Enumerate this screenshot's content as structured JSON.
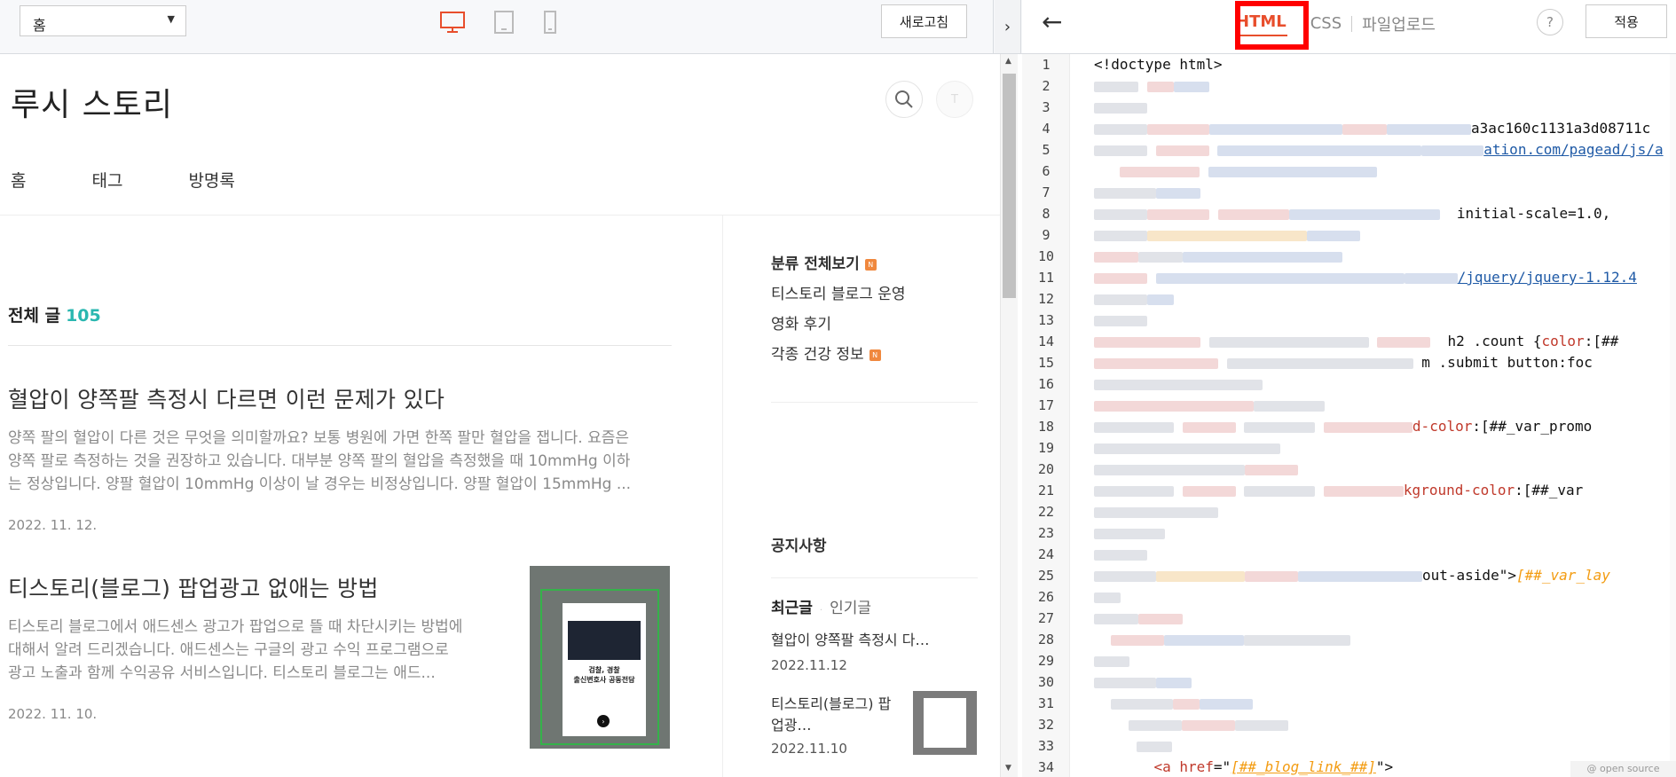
{
  "preview_bar": {
    "page_select": {
      "value": "홈"
    },
    "refresh_label": "새로고침",
    "collapse_label": "›"
  },
  "editor_bar": {
    "back_label": "←",
    "tabs": [
      {
        "label": "HTML",
        "active": true
      },
      {
        "label": "CSS",
        "active": false
      },
      {
        "label": "파일업로드",
        "active": false
      }
    ],
    "help_label": "?",
    "apply_label": "적용",
    "accent_color": "#e84e2c",
    "highlight_color": "#ff0000"
  },
  "blog": {
    "title": "루시 스토리",
    "profile_initial": "T",
    "nav": [
      "홈",
      "태그",
      "방명록"
    ],
    "total_label": "전체 글",
    "total_count": "105",
    "posts": [
      {
        "title": "혈압이 양쪽팔 측정시 다르면 이런 문제가 있다",
        "excerpt": "양쪽 팔의 혈압이 다른 것은 무엇을 의미할까요? 보통 병원에 가면 한쪽 팔만 혈압을 잽니다. 요즘은 양쪽 팔로 측정하는 것을 권장하고 있습니다. 대부분 양쪽 팔의 혈압을 측정했을 때 10mmHg 이하는 정상입니다. 양팔 혈압이 10mmHg 이상이 날 경우는 비정상입니다. 양팔 혈압이 15mmHg ...",
        "date": "2022. 11. 12."
      },
      {
        "title": "티스토리(블로그) 팝업광고 없애는 방법",
        "excerpt": "티스토리 블로그에서 애드센스 광고가 팝업으로 뜰 때 차단시키는 방법에 대해서 알려 드리겠습니다. 애드센스는 구글의 광고 수익 프로그램으로 광고 노출과 함께 수익공유 서비스입니다. 티스토리 블로그는 애드...",
        "date": "2022. 11. 10.",
        "thumb_text": "검찰, 경찰\n출신변호사 공동전담"
      }
    ],
    "sidebar": {
      "categories_head": "분류 전체보기",
      "new_badge": "N",
      "categories": [
        {
          "label": "티스토리 블로그 운영",
          "new": false
        },
        {
          "label": "영화 후기",
          "new": false
        },
        {
          "label": "각종 건강 정보",
          "new": true
        }
      ],
      "notice_head": "공지사항",
      "tab_recent": "최근글",
      "tab_popular": "인기글",
      "recent": [
        {
          "title": "혈압이 양쪽팔 측정시 다…",
          "date": "2022.11.12"
        },
        {
          "title_line1": "티스토리(블로그) 팝",
          "title_line2": "업광…",
          "date": "2022.11.10"
        }
      ]
    }
  },
  "code": {
    "line_numbers": [
      "1",
      "2",
      "3",
      "4",
      "5",
      "6",
      "7",
      "8",
      "9",
      "10",
      "11",
      "12",
      "13",
      "14",
      "15",
      "16",
      "17",
      "18",
      "19",
      "20",
      "21",
      "22",
      "23",
      "24",
      "25",
      "26",
      "27",
      "28",
      "29",
      "30",
      "31",
      "32",
      "33",
      "34"
    ],
    "line1": "<!doctype html>",
    "line4_tail": "a3ac160c1131a3d08711c",
    "line5_tail": "ation.com/pagead/js/a",
    "line8_tail": "initial-scale=1.0,",
    "line11_tail": "/jquery/jquery-1.12.4",
    "line14_tail_a": "h2 .count {",
    "line14_tail_b": "color",
    "line14_tail_c": ":[##",
    "line15_tail": "m .submit button:foc",
    "line18_tail_a": "d-color",
    "line18_tail_b": ":[##_var_promo",
    "line21_tail_a": "kground-color",
    "line21_tail_b": ":[##_var",
    "line25_tail_a": "out-aside\">",
    "line25_tail_b": "[##_var_lay",
    "line34_a": "<a ",
    "line34_attr": "href",
    "line34_eq": "=\"",
    "line34_val": "[##_blog_link_##]",
    "line34_end": "\">",
    "opensource": "@ open source"
  }
}
